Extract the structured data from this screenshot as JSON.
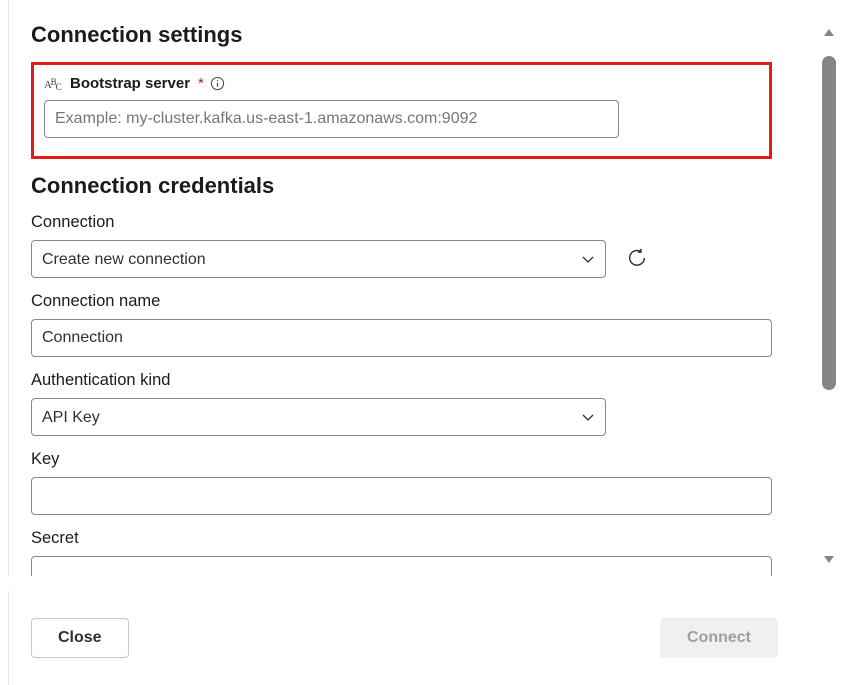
{
  "sections": {
    "connection_settings_title": "Connection settings",
    "connection_credentials_title": "Connection credentials"
  },
  "bootstrap": {
    "label": "Bootstrap server",
    "placeholder": "Example: my-cluster.kafka.us-east-1.amazonaws.com:9092",
    "value": ""
  },
  "connection": {
    "label": "Connection",
    "selected": "Create new connection"
  },
  "connection_name": {
    "label": "Connection name",
    "value": "Connection"
  },
  "auth_kind": {
    "label": "Authentication kind",
    "selected": "API Key"
  },
  "key": {
    "label": "Key",
    "value": ""
  },
  "secret": {
    "label": "Secret",
    "value": ""
  },
  "buttons": {
    "close": "Close",
    "connect": "Connect"
  }
}
